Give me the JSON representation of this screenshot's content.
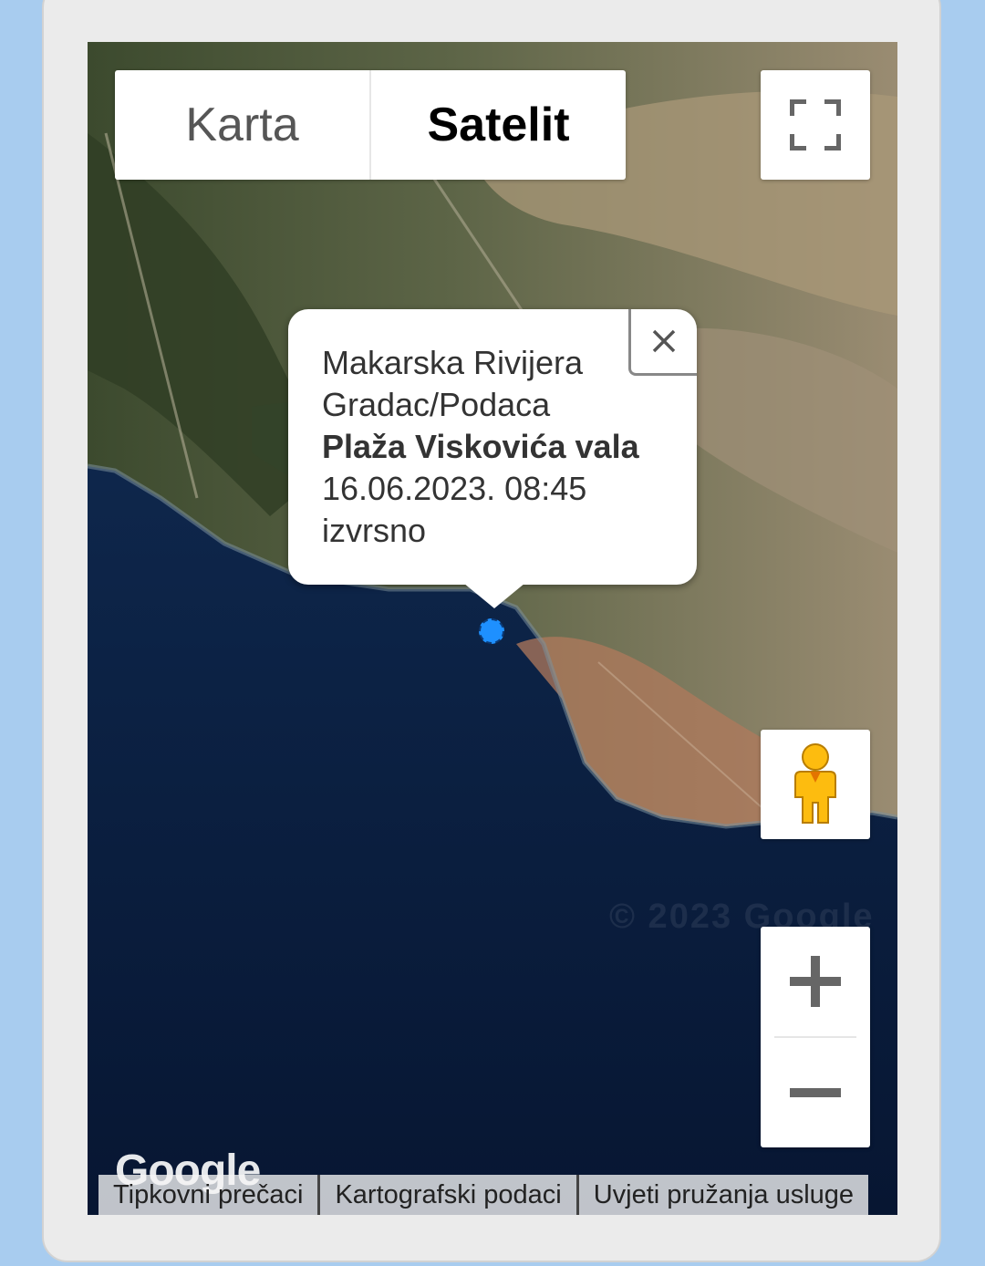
{
  "map": {
    "type_buttons": [
      {
        "label": "Karta",
        "active": false
      },
      {
        "label": "Satelit",
        "active": true
      }
    ],
    "icons": {
      "fullscreen": "fullscreen-icon",
      "pegman": "pegman-icon",
      "zoom_in": "plus-icon",
      "zoom_out": "minus-icon",
      "close": "close-icon"
    },
    "infowindow": {
      "region": "Makarska Rivijera",
      "location": "Gradac/Podaca",
      "beach": "Plaža Viskovića vala",
      "datetime": "16.06.2023. 08:45",
      "quality": "izvrsno"
    },
    "watermark": "© 2023 Google",
    "logo": "Google",
    "footer": {
      "shortcuts": "Tipkovni prečaci",
      "map_data": "Kartografski podaci",
      "terms": "Uvjeti pružanja usluge"
    },
    "colors": {
      "sea": "#0a1d3d",
      "marker": "#1e90ff",
      "page_bg": "#a8ccef"
    }
  }
}
